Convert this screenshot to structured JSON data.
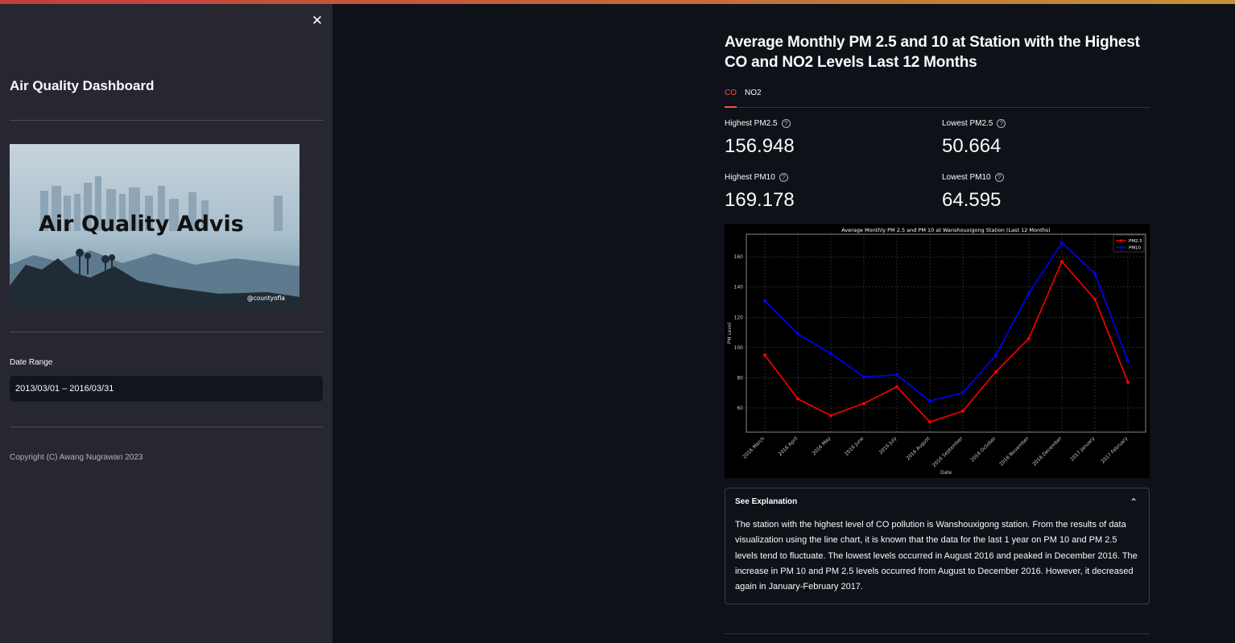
{
  "sidebar": {
    "title": "Air Quality Dashboard",
    "image": {
      "text": "Air Quality Advis",
      "watermark": "@countyofla"
    },
    "date_label": "Date Range",
    "date_value": "2013/03/01 – 2016/03/31",
    "copyright": "Copyright (C) Awang Nugrawan 2023",
    "close_icon": "close-icon"
  },
  "main": {
    "title": "Average Monthly PM 2.5 and 10 at Station with the Highest CO and NO2 Levels Last 12 Months",
    "tabs": [
      {
        "label": "CO",
        "active": true
      },
      {
        "label": "NO2",
        "active": false
      }
    ],
    "metrics": {
      "highest_pm25": {
        "label": "Highest PM2.5",
        "value": "156.948"
      },
      "lowest_pm25": {
        "label": "Lowest PM2.5",
        "value": "50.664"
      },
      "highest_pm10": {
        "label": "Highest PM10",
        "value": "169.178"
      },
      "lowest_pm10": {
        "label": "Lowest PM10",
        "value": "64.595"
      }
    },
    "expander": {
      "title": "See Explanation",
      "text": "The station with the highest level of CO pollution is Wanshouxigong station. From the results of data visualization using the line chart, it is known that the data for the last 1 year on PM 10 and PM 2.5 levels tend to fluctuate. The lowest levels occurred in August 2016 and peaked in December 2016. The increase in PM 10 and PM 2.5 levels occurred from August to December 2016. However, it decreased again in January-February 2017."
    }
  },
  "colors": {
    "accent": "#ff4b4b",
    "pm25": "#ff0000",
    "pm10": "#0000ff"
  },
  "chart_data": {
    "type": "line",
    "title": "Average Monthly PM 2.5 and PM 10 at Wanshouxigong Station (Last 12 Months)",
    "xlabel": "Date",
    "ylabel": "PM Level",
    "categories": [
      "2016 March",
      "2016 April",
      "2016 May",
      "2016 June",
      "2016 July",
      "2016 August",
      "2016 September",
      "2016 October",
      "2016 November",
      "2016 December",
      "2017 January",
      "2017 February"
    ],
    "series": [
      {
        "name": "PM2.5",
        "color": "#ff0000",
        "values": [
          95,
          66,
          55,
          63,
          74,
          50.7,
          58,
          84,
          106,
          156.9,
          132,
          77
        ]
      },
      {
        "name": "PM10",
        "color": "#0000ff",
        "values": [
          131,
          109,
          96,
          80.5,
          82,
          64.6,
          70,
          95,
          136,
          169.2,
          149,
          91
        ]
      }
    ],
    "yticks": [
      60,
      80,
      100,
      120,
      140,
      160
    ],
    "ylim": [
      44,
      175
    ],
    "grid": true,
    "legend": "top-right"
  }
}
